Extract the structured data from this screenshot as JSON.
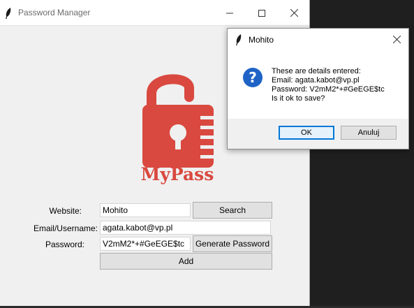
{
  "main_window": {
    "title": "Password Manager",
    "logo_text": "MyPass"
  },
  "form": {
    "website_label": "Website:",
    "website_value": "Mohito",
    "search_label": "Search",
    "email_label": "Email/Username:",
    "email_value": "agata.kabot@vp.pl",
    "password_label": "Password:",
    "password_value": "V2mM2*+#GeEGE$tc",
    "generate_label": "Generate Password",
    "add_label": "Add"
  },
  "dialog": {
    "title": "Mohito",
    "icon": "question-icon",
    "message_lines": [
      "These are details entered:",
      "Email: agata.kabot@vp.pl",
      "Password: V2mM2*+#GeEGE$tc",
      "Is it ok to save?"
    ],
    "ok_label": "OK",
    "cancel_label": "Anuluj"
  },
  "colors": {
    "logo_red": "#d9493f",
    "accent": "#0078d7"
  }
}
